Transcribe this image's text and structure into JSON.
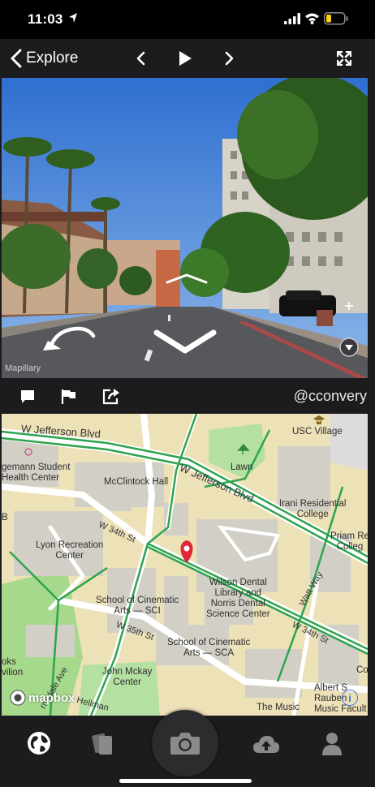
{
  "status": {
    "time": "11:03",
    "icons": [
      "location-arrow-icon",
      "signal-icon",
      "wifi-icon",
      "battery-low-icon"
    ],
    "battery_color": "#f5d313"
  },
  "nav": {
    "back_label": "Explore",
    "icons": [
      "chevron-left-icon",
      "play-icon",
      "chevron-right-icon",
      "expand-icon"
    ]
  },
  "photo": {
    "attribution": "Mapillary",
    "icons": [
      "rotate-back-arrow-icon",
      "forward-chevron-icon",
      "compass-icon",
      "plus-icon"
    ]
  },
  "actions": {
    "username": "@cconvery",
    "icons": [
      "comment-icon",
      "flag-icon",
      "share-icon"
    ]
  },
  "map": {
    "pin_color": "#e0283a",
    "places": [
      {
        "id": "usc-village",
        "label": "USC Village"
      },
      {
        "id": "lawn",
        "label": "Lawn"
      },
      {
        "id": "mcclintock",
        "label": "McClintock Hall"
      },
      {
        "id": "irani",
        "label": "Irani Residential\nCollege"
      },
      {
        "id": "priam",
        "label": "Priam Re\nColleg"
      },
      {
        "id": "lyon",
        "label": "Lyon Recreation\nCenter"
      },
      {
        "id": "student-health",
        "label": "gemann Student\nHealth Center"
      },
      {
        "id": "wilson",
        "label": "Wilson Dental\nLibrary and\nNorris Dental\nScience Center"
      },
      {
        "id": "cinematic-sci",
        "label": "School of Cinematic\nArts — SCI"
      },
      {
        "id": "cinematic-sca",
        "label": "School of Cinematic\nArts — SCA"
      },
      {
        "id": "mckay",
        "label": "John Mckay\nCenter"
      },
      {
        "id": "music",
        "label": "The Music"
      },
      {
        "id": "rauben",
        "label": "Albert S\nRauben\nMusic Facult"
      },
      {
        "id": "oks",
        "label": "oks\nvilion"
      },
      {
        "id": "b",
        "label": "B"
      },
      {
        "id": "co",
        "label": "Co"
      }
    ],
    "streets": [
      {
        "id": "w-jefferson-1",
        "label": "W Jefferson Blvd"
      },
      {
        "id": "w-jefferson-2",
        "label": "W Jefferson Blvd"
      },
      {
        "id": "w-34th-1",
        "label": "W 34th St"
      },
      {
        "id": "w-34th-2",
        "label": "W 34th St"
      },
      {
        "id": "w-35th",
        "label": "W 35th St"
      },
      {
        "id": "watt-way",
        "label": "Watt Way"
      },
      {
        "id": "trousdale",
        "label": "rnsdale Ave"
      },
      {
        "id": "hellman",
        "label": "Hellman"
      }
    ],
    "attribution": "mapbox",
    "info_label": "i"
  },
  "tabs": {
    "items": [
      "globe-icon",
      "cards-icon",
      "camera-icon",
      "cloud-upload-icon",
      "profile-icon"
    ]
  }
}
